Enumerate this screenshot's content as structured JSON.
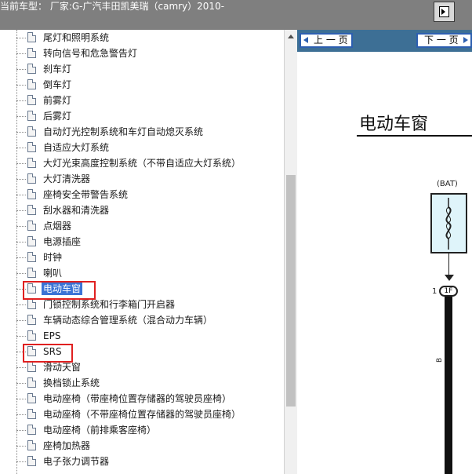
{
  "header": {
    "title": "当前车型：  厂家:G-广汽丰田凯美瑞（camry）2010-",
    "button_icon": "expand-panel-icon"
  },
  "tree": {
    "items": [
      {
        "label": "尾灯和照明系统"
      },
      {
        "label": "转向信号和危急警告灯"
      },
      {
        "label": "刹车灯"
      },
      {
        "label": "倒车灯"
      },
      {
        "label": "前雾灯"
      },
      {
        "label": "后雾灯"
      },
      {
        "label": "自动灯光控制系统和车灯自动熄灭系统"
      },
      {
        "label": "自适应大灯系统"
      },
      {
        "label": "大灯光束高度控制系统（不带自适应大灯系统）"
      },
      {
        "label": "大灯清洗器"
      },
      {
        "label": "座椅安全带警告系统"
      },
      {
        "label": "刮水器和清洗器"
      },
      {
        "label": "点烟器"
      },
      {
        "label": "电源插座"
      },
      {
        "label": "时钟"
      },
      {
        "label": "喇叭"
      },
      {
        "label": "电动车窗",
        "selected": true,
        "highlighted": true
      },
      {
        "label": "门锁控制系统和行李箱门开启器"
      },
      {
        "label": "车辆动态综合管理系统（混合动力车辆）"
      },
      {
        "label": "EPS"
      },
      {
        "label": "SRS",
        "highlighted": true
      },
      {
        "label": "滑动天窗"
      },
      {
        "label": "换档锁止系统"
      },
      {
        "label": "电动座椅（带座椅位置存储器的驾驶员座椅）"
      },
      {
        "label": "电动座椅（不带座椅位置存储器的驾驶员座椅）"
      },
      {
        "label": "电动座椅（前排乘客座椅）"
      },
      {
        "label": "座椅加热器"
      },
      {
        "label": "电子张力调节器"
      }
    ]
  },
  "document": {
    "prev_label": "上 一 页",
    "next_label": "下 一 页",
    "title": "电动车窗",
    "bat_label": "(BAT)",
    "connector_pin": "1",
    "connector_label": "1F",
    "wire_code": "B"
  },
  "colors": {
    "header_bg": "#7f7f7f",
    "nav_bg": "#3d6f95",
    "selection": "#3a73d6",
    "highlight_box": "#e02020"
  }
}
